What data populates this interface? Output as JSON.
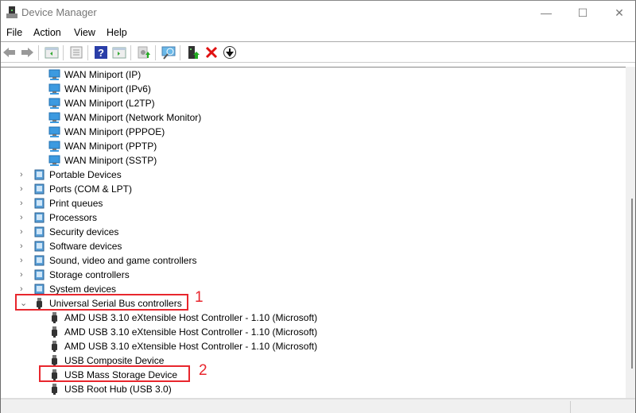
{
  "window": {
    "title": "Device Manager",
    "minimize_label": "—",
    "maximize_label": "☐",
    "close_label": "✕"
  },
  "menu": [
    "File",
    "Action",
    "View",
    "Help"
  ],
  "toolbar": [
    "back-icon",
    "forward-icon",
    "show-hide-console-tree-icon",
    "properties-icon",
    "help-icon",
    "show-action-pane-icon",
    "update-driver-icon",
    "scan-hardware-icon",
    "enable-device-icon",
    "uninstall-device-icon",
    "disable-device-icon"
  ],
  "tree": {
    "network_children": [
      "WAN Miniport (IP)",
      "WAN Miniport (IPv6)",
      "WAN Miniport (L2TP)",
      "WAN Miniport (Network Monitor)",
      "WAN Miniport (PPPOE)",
      "WAN Miniport (PPTP)",
      "WAN Miniport (SSTP)"
    ],
    "categories": [
      "Portable Devices",
      "Ports (COM & LPT)",
      "Print queues",
      "Processors",
      "Security devices",
      "Software devices",
      "Sound, video and game controllers",
      "Storage controllers",
      "System devices"
    ],
    "usb": {
      "label": "Universal Serial Bus controllers",
      "expanded": true,
      "children": [
        "AMD USB 3.10 eXtensible Host Controller - 1.10 (Microsoft)",
        "AMD USB 3.10 eXtensible Host Controller - 1.10 (Microsoft)",
        "AMD USB 3.10 eXtensible Host Controller - 1.10 (Microsoft)",
        "USB Composite Device",
        "USB Mass Storage Device",
        "USB Root Hub (USB 3.0)"
      ]
    }
  },
  "annotations": {
    "one": "1",
    "two": "2",
    "color": "#e8262d"
  },
  "scrollbar": {
    "position_fraction": 0.85
  }
}
